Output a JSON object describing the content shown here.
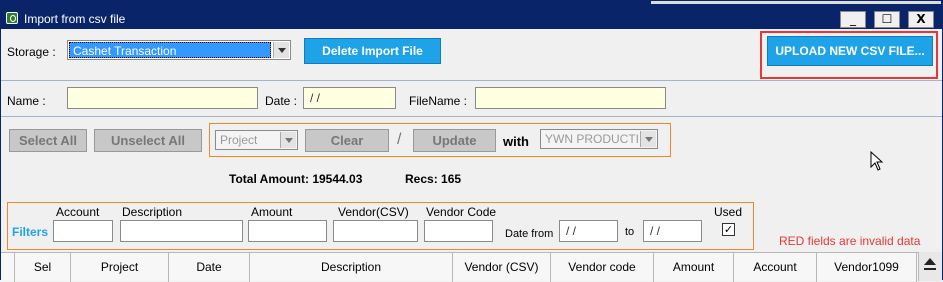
{
  "window": {
    "title": "Import from csv file",
    "controls": {
      "minimize": "_",
      "maximize": "☐",
      "close": "X"
    }
  },
  "toolbar": {
    "storage_label": "Storage :",
    "storage_value": "Cashet Transaction",
    "delete_import_label": "Delete Import File",
    "upload_label": "UPLOAD NEW CSV FILE..."
  },
  "info": {
    "name_label": "Name :",
    "name_value": "",
    "date_label": "Date :",
    "date_value": "/ /",
    "filename_label": "FileName :",
    "filename_value": ""
  },
  "actions": {
    "select_all": "Select All",
    "unselect_all": "Unselect All",
    "field_select": "Project",
    "clear": "Clear",
    "slash": "/",
    "update": "Update",
    "with_label": "with",
    "with_value": "YWN PRODUCTIC"
  },
  "summary": {
    "total_amount": "Total Amount: 19544.03",
    "recs": "Recs: 165"
  },
  "filters": {
    "label": "Filters",
    "account_label": "Account",
    "description_label": "Description",
    "amount_label": "Amount",
    "vendor_csv_label": "Vendor(CSV)",
    "vendor_code_label": "Vendor Code",
    "date_from_label": "Date from",
    "date_from_value": "/ /",
    "to_label": "to",
    "date_to_value": "/ /",
    "used_label": "Used",
    "used_checked": "✓"
  },
  "note": "RED fields are invalid data",
  "grid": {
    "columns": [
      "Sel",
      "Project",
      "Date",
      "Description",
      "Vendor (CSV)",
      "Vendor code",
      "Amount",
      "Account",
      "Vendor1099"
    ]
  },
  "colors": {
    "titlebar": "#0a246a",
    "accent_button": "#1fa3e8",
    "highlight_box": "#e53935",
    "group_border": "#f08a24",
    "field_fill": "#ffffe1"
  }
}
